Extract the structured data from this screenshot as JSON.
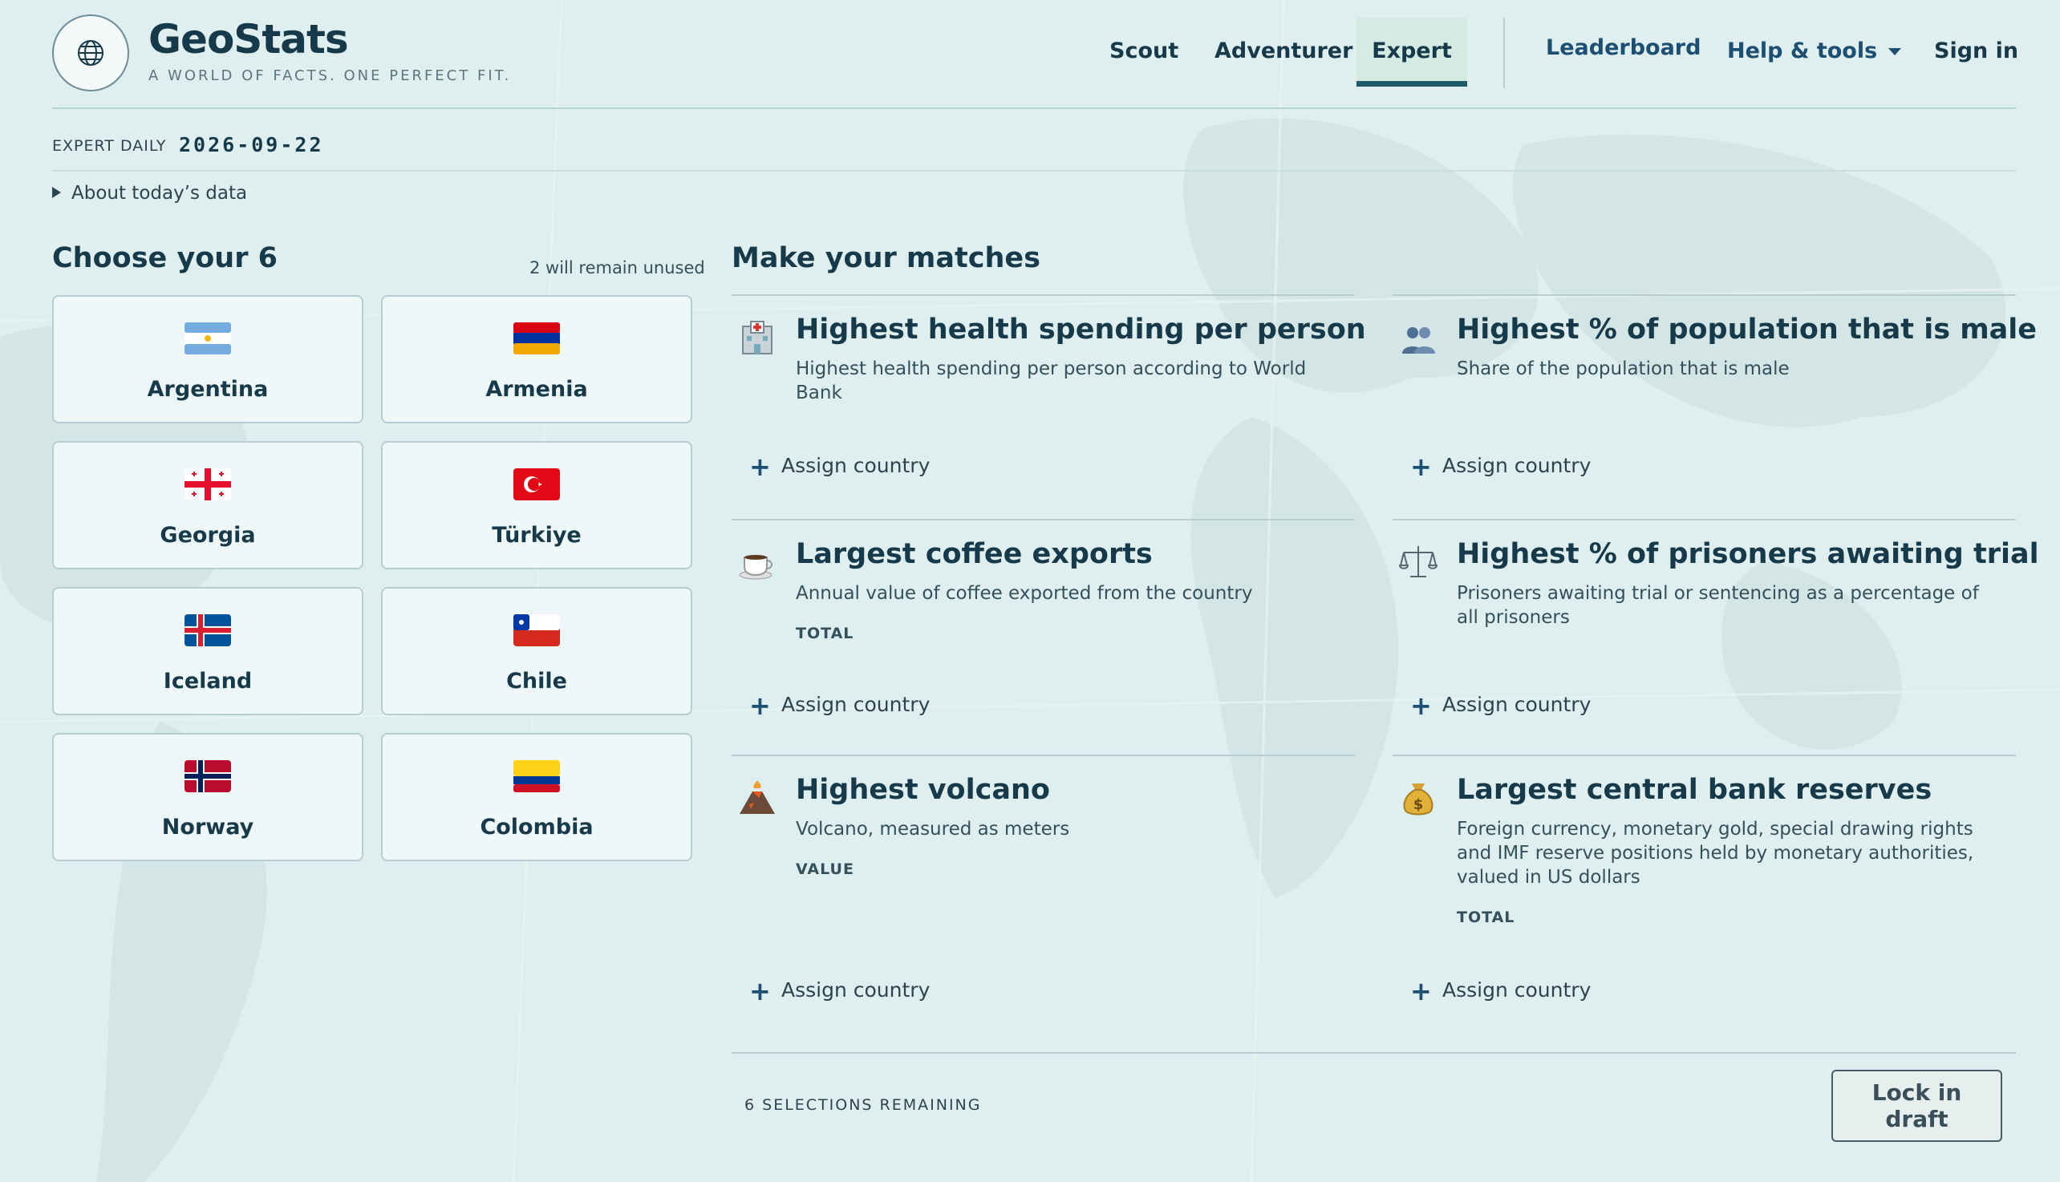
{
  "app": {
    "name": "GeoStats",
    "tagline": "A WORLD OF FACTS. ONE PERFECT FIT."
  },
  "nav": {
    "items": [
      "Scout",
      "Adventurer",
      "Expert"
    ],
    "active": "Expert",
    "leaderboard": "Leaderboard",
    "help": "Help & tools",
    "signin": "Sign in"
  },
  "daily": {
    "label": "EXPERT DAILY",
    "date": "2026-09-22",
    "about": "About today’s data"
  },
  "choose": {
    "title": "Choose your 6",
    "note": "2 will remain unused",
    "countries": [
      {
        "name": "Argentina",
        "flag": "argentina-flag"
      },
      {
        "name": "Armenia",
        "flag": "armenia-flag"
      },
      {
        "name": "Georgia",
        "flag": "georgia-flag"
      },
      {
        "name": "Türkiye",
        "flag": "turkiye-flag"
      },
      {
        "name": "Iceland",
        "flag": "iceland-flag"
      },
      {
        "name": "Chile",
        "flag": "chile-flag"
      },
      {
        "name": "Norway",
        "flag": "norway-flag"
      },
      {
        "name": "Colombia",
        "flag": "colombia-flag"
      }
    ]
  },
  "matches": {
    "title": "Make your matches",
    "assign_label": "Assign country",
    "categories": [
      {
        "icon": "hospital-icon",
        "title": "Highest health spending per person",
        "desc": "Highest health spending per person according to World Bank",
        "tag": ""
      },
      {
        "icon": "people-icon",
        "title": "Highest % of population that is male",
        "desc": "Share of the population that is male",
        "tag": ""
      },
      {
        "icon": "coffee-icon",
        "title": "Largest coffee exports",
        "desc": "Annual value of coffee exported from the country",
        "tag": "TOTAL"
      },
      {
        "icon": "scales-icon",
        "title": "Highest % of prisoners awaiting trial",
        "desc": "Prisoners awaiting trial or sentencing as a percentage of all prisoners",
        "tag": ""
      },
      {
        "icon": "volcano-icon",
        "title": "Highest volcano",
        "desc": "Volcano, measured as meters",
        "tag": "VALUE"
      },
      {
        "icon": "money-bag-icon",
        "title": "Largest central bank reserves",
        "desc": "Foreign currency, monetary gold, special drawing rights and IMF reserve positions held by monetary authorities, valued in US dollars",
        "tag": "TOTAL"
      }
    ]
  },
  "footer": {
    "remaining": "6 SELECTIONS REMAINING",
    "lock_button": "Lock in draft"
  },
  "colors": {
    "background": "#dfeeef",
    "text": "#173a4b",
    "accent": "#1f5866",
    "active_tab": "#d3ebe2"
  }
}
